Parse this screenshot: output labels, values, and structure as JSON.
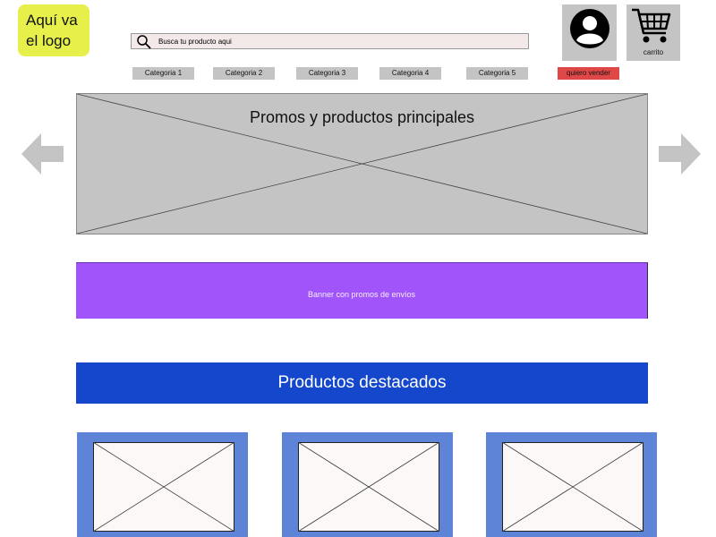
{
  "logo": {
    "text": "Aquí va\nel logo"
  },
  "search": {
    "placeholder": "Busca tu producto aqui"
  },
  "account": {
    "icon": "user-icon"
  },
  "cart": {
    "icon": "cart-icon",
    "label": "carrito"
  },
  "categories": [
    "Categoria 1",
    "Categoria 2",
    "Categoria 3",
    "Categoria 4",
    "Categoria 5"
  ],
  "sell_button": {
    "label": "quiero vender",
    "color": "#e04848"
  },
  "hero": {
    "title": "Promos y productos principales",
    "prev_icon": "arrow-left-icon",
    "next_icon": "arrow-right-icon"
  },
  "shipping_banner": {
    "text": "Banner con promos de envíos",
    "color": "#a154f9"
  },
  "featured": {
    "title": "Productos destacados",
    "color": "#1447cc"
  },
  "product_cards": [
    {
      "icon": "image-placeholder-icon"
    },
    {
      "icon": "image-placeholder-icon"
    },
    {
      "icon": "image-placeholder-icon"
    }
  ]
}
